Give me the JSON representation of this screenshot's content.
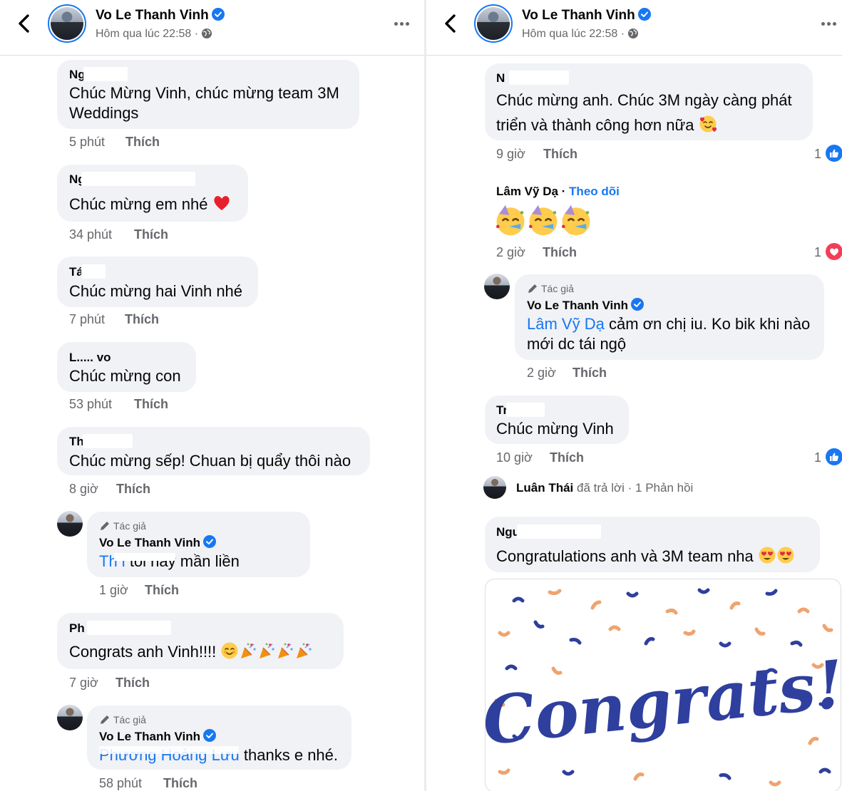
{
  "post": {
    "author": "Vo Le Thanh Vinh",
    "time": "Hôm qua lúc 22:58 ·"
  },
  "colors": {
    "link_blue": "#1877f2",
    "meta_gray": "#65676b",
    "bubble_bg": "#f0f2f5",
    "like_blue": "#1877f2",
    "heart_red": "#f33e58",
    "confetti_blue": "#2e3f9e",
    "confetti_orange": "#f0a36e"
  },
  "left": {
    "comments": [
      {
        "author": "Ng d",
        "text": "Chúc Mừng Vinh, chúc mừng team 3M Weddings",
        "time": "5 phút",
        "like": "Thích",
        "emoji": "none"
      },
      {
        "author": "Ng n",
        "text": "Chúc mừng em nhé",
        "emoji": "heart-emoji",
        "time": "34 phút",
        "like": "Thích"
      },
      {
        "author": "Tá ê",
        "text": "Chúc mừng hai Vinh nhé",
        "time": "7 phút",
        "like": "Thích"
      },
      {
        "author": "L..... vo",
        "text": "Chúc mừng con",
        "time": "53 phút",
        "like": "Thích"
      },
      {
        "author": "Th i",
        "text": "Chúc mừng sếp! Chuan bị quẩy thôi nào",
        "time": "8 giờ",
        "like": "Thích"
      }
    ],
    "reply1": {
      "tag": "Tác giả",
      "author": "Vo Le Thanh Vinh",
      "mention": "Th i",
      "text": "tối nay mần liền",
      "time": "1 giờ",
      "like": "Thích"
    },
    "comment6": {
      "author": "Ph u",
      "text": "Congrats anh Vinh!!!!",
      "time": "7 giờ",
      "like": "Thích"
    },
    "reply2": {
      "tag": "Tác giả",
      "author": "Vo Le Thanh Vinh",
      "mention": "Phương Hoàng Lưu",
      "text": "thanks e nhé.",
      "time": "58 phút",
      "like": "Thích"
    }
  },
  "right": {
    "c1": {
      "author": "N n",
      "text": "Chúc mừng anh. Chúc 3M ngày càng phát triển và thành công hơn nữa",
      "time": "9 giờ",
      "like": "Thích",
      "reactions": "1"
    },
    "c2": {
      "author": "Lâm Vỹ Dạ",
      "follow": "Theo dõi",
      "time": "2 giờ",
      "like": "Thích",
      "reactions": "1"
    },
    "reply": {
      "tag": "Tác giả",
      "author": "Vo Le Thanh Vinh",
      "mention": "Lâm Vỹ Dạ",
      "text": "cảm ơn chị iu. Ko bik khi nào mới dc tái ngộ",
      "time": "2 giờ",
      "like": "Thích"
    },
    "c3": {
      "author": "Tr õ",
      "text": "Chúc mừng Vinh",
      "time": "10 giờ",
      "like": "Thích",
      "reactions": "1"
    },
    "thread": {
      "name": "Luân Thái",
      "action": "đã trả lời",
      "count": "· 1 Phản hồi"
    },
    "c4": {
      "author": "Ngu g",
      "text": "Congratulations anh và 3M team nha",
      "image_text": "Congrats!"
    }
  }
}
